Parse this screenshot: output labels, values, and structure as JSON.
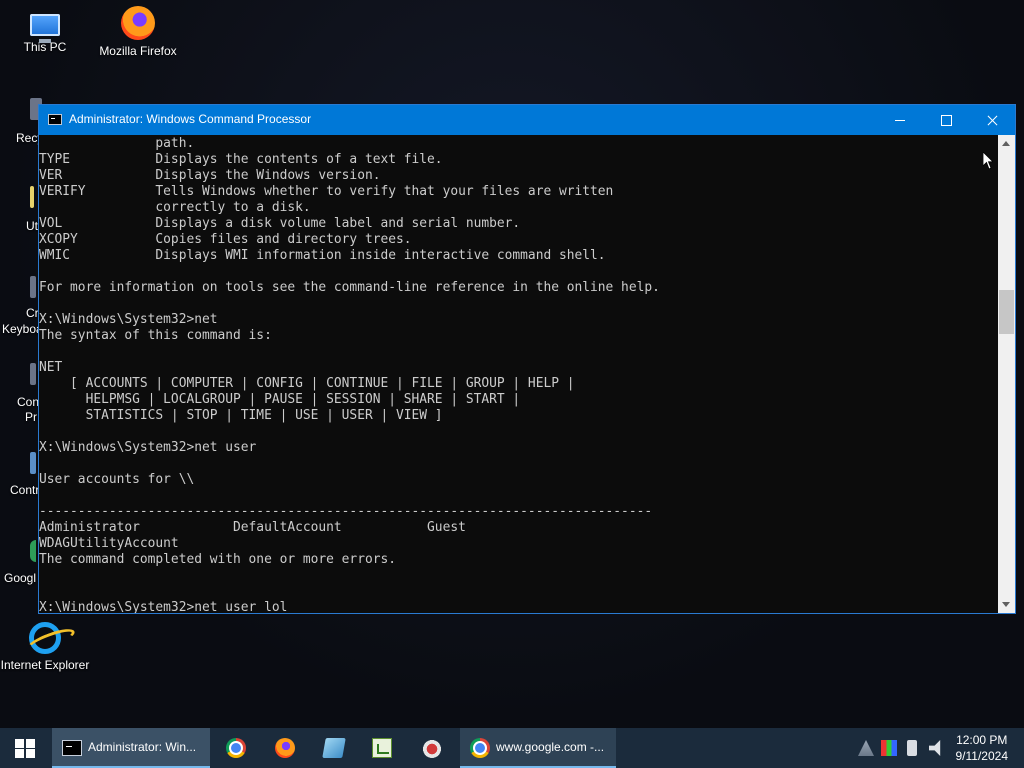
{
  "desktop": {
    "icons": [
      {
        "label": "This PC"
      },
      {
        "label": "Mozilla Firefox"
      },
      {
        "label": "Internet Explorer"
      }
    ],
    "partial_labels": [
      "Recy",
      "Ut",
      "Cr",
      "Keyboa",
      "Con",
      "Pr",
      "Contr",
      "Googl"
    ]
  },
  "window": {
    "title": "Administrator: Windows Command Processor",
    "console_lines": [
      "               path.",
      "TYPE           Displays the contents of a text file.",
      "VER            Displays the Windows version.",
      "VERIFY         Tells Windows whether to verify that your files are written",
      "               correctly to a disk.",
      "VOL            Displays a disk volume label and serial number.",
      "XCOPY          Copies files and directory trees.",
      "WMIC           Displays WMI information inside interactive command shell.",
      "",
      "For more information on tools see the command-line reference in the online help.",
      "",
      "X:\\Windows\\System32>net",
      "The syntax of this command is:",
      "",
      "NET",
      "    [ ACCOUNTS | COMPUTER | CONFIG | CONTINUE | FILE | GROUP | HELP |",
      "      HELPMSG | LOCALGROUP | PAUSE | SESSION | SHARE | START |",
      "      STATISTICS | STOP | TIME | USE | USER | VIEW ]",
      "",
      "X:\\Windows\\System32>net user",
      "",
      "User accounts for \\\\",
      "",
      "-------------------------------------------------------------------------------",
      "Administrator            DefaultAccount           Guest",
      "WDAGUtilityAccount",
      "The command completed with one or more errors.",
      "",
      "",
      "X:\\Windows\\System32>net user lol"
    ]
  },
  "taskbar": {
    "items": [
      {
        "label": "Administrator: Win..."
      },
      {
        "label": "www.google.com -..."
      }
    ],
    "clock": {
      "time": "12:00 PM",
      "date": "9/11/2024"
    }
  }
}
